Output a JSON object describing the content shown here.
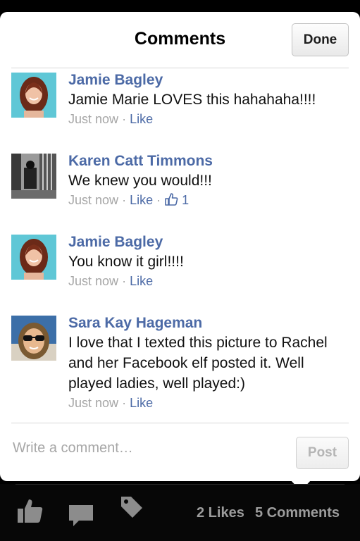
{
  "header": {
    "title": "Comments",
    "done_label": "Done"
  },
  "comments": [
    {
      "name": "Jamie Bagley",
      "lines": [
        "Jamie Marie LOVES this hahahaha!!!!"
      ],
      "time": "Just now",
      "like": "Like",
      "sep": "·",
      "avatar": "redhead-woman-photo"
    },
    {
      "name": "Karen Catt Timmons",
      "lines": [
        "We knew you would!!!"
      ],
      "time": "Just now",
      "like": "Like",
      "sep": "·",
      "like_count": "1",
      "avatar": "black-and-white-photo"
    },
    {
      "name": "Jamie Bagley",
      "lines": [
        "You know it girl!!!!"
      ],
      "time": "Just now",
      "like": "Like",
      "sep": "·",
      "avatar": "redhead-woman-photo"
    },
    {
      "name": "Sara Kay Hageman",
      "lines": [
        "I love that I texted this picture to Rachel",
        "and her Facebook elf posted it. Well",
        "played ladies, well played:)"
      ],
      "time": "Just now",
      "like": "Like",
      "sep": "·",
      "avatar": "woman-sunglasses-photo"
    }
  ],
  "composer": {
    "placeholder": "Write a comment…",
    "post_label": "Post"
  },
  "bottom_bar": {
    "likes": "2 Likes",
    "comments": "5 Comments",
    "icons": [
      "like-icon",
      "comment-icon",
      "tag-icon"
    ]
  },
  "colors": {
    "link": "#4c6aa6",
    "meta": "#a6a6a6",
    "background": "#000000"
  }
}
